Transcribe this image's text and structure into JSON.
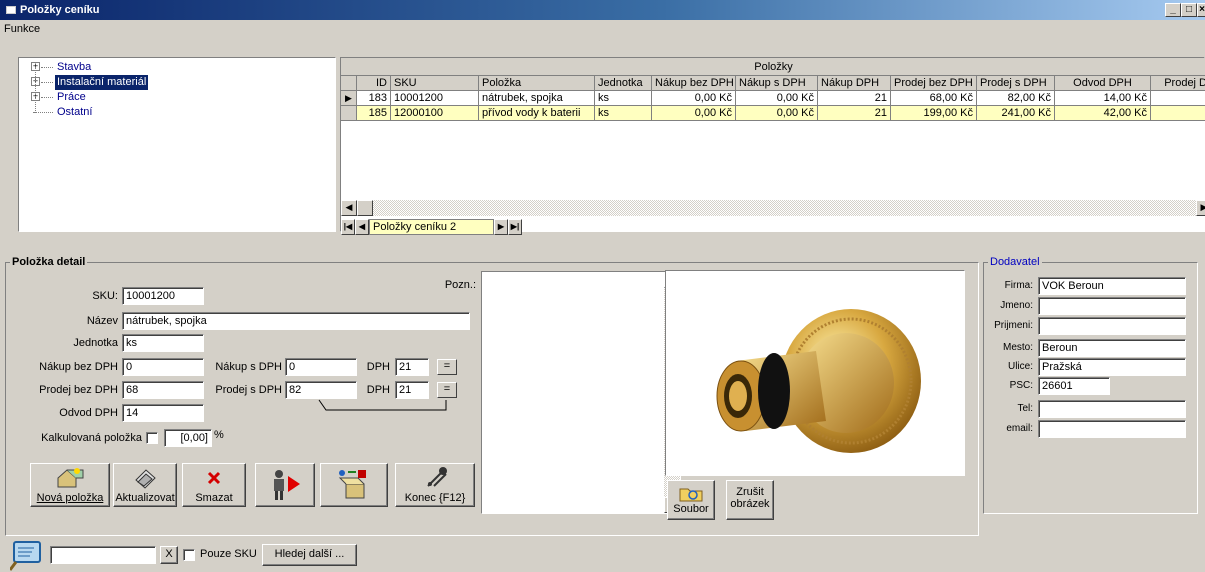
{
  "window": {
    "title": "Položky ceníku"
  },
  "menu": {
    "funkce": "Funkce"
  },
  "tree": {
    "items": [
      {
        "label": "Stavba",
        "expander": "+",
        "selected": false
      },
      {
        "label": "Instalační materiál",
        "expander": "+",
        "selected": true
      },
      {
        "label": "Práce",
        "expander": "+",
        "selected": false
      },
      {
        "label": "Ostatní",
        "expander": "",
        "selected": false
      }
    ]
  },
  "grid": {
    "title": "Položky",
    "columns": [
      "ID",
      "SKU",
      "Položka",
      "Jednotka",
      "Nákup bez DPH",
      "Nákup s DPH",
      "Nákup DPH",
      "Prodej bez DPH",
      "Prodej s DPH",
      "Odvod DPH",
      "Prodej D"
    ],
    "rows": [
      {
        "id": "183",
        "sku": "10001200",
        "polozka": "nátrubek, spojka",
        "jednotka": "ks",
        "nakup_bez": "0,00 Kč",
        "nakup_s": "0,00 Kč",
        "nakup_dph": "21",
        "prodej_bez": "68,00 Kč",
        "prodej_s": "82,00 Kč",
        "odvod": "14,00 Kč"
      },
      {
        "id": "185",
        "sku": "12000100",
        "polozka": "přívod vody k baterii",
        "jednotka": "ks",
        "nakup_bez": "0,00 Kč",
        "nakup_s": "0,00 Kč",
        "nakup_dph": "21",
        "prodej_bez": "199,00 Kč",
        "prodej_s": "241,00 Kč",
        "odvod": "42,00 Kč"
      }
    ],
    "nav_label": "Položky ceníku 2"
  },
  "detail": {
    "title": "Položka detail",
    "sku_label": "SKU:",
    "sku_value": "10001200",
    "nazev_label": "Název",
    "nazev_value": "nátrubek, spojka",
    "jednotka_label": "Jednotka",
    "jednotka_value": "ks",
    "nakup_bez_label": "Nákup bez DPH",
    "nakup_bez_value": "0",
    "nakup_s_label": "Nákup s DPH",
    "nakup_s_value": "0",
    "dph_label": "DPH",
    "dph1_value": "21",
    "dph2_value": "21",
    "prodej_bez_label": "Prodej bez DPH",
    "prodej_bez_value": "68",
    "prodej_s_label": "Prodej s DPH",
    "prodej_s_value": "82",
    "odvod_label": "Odvod DPH",
    "odvod_value": "14",
    "kalk_label": "Kalkulovaná položka",
    "kalk_value": "[0,00]",
    "kalk_unit": "%",
    "eq": "=",
    "pozn_label": "Pozn.:"
  },
  "buttons": {
    "nova": "Nová položka",
    "aktualizovat": "Aktualizovat",
    "smazat": "Smazat",
    "konec": "Konec {F12}",
    "soubor": "Soubor",
    "zrusit1": "Zrušit",
    "zrusit2": "obrázek"
  },
  "dodavatel": {
    "title": "Dodavatel",
    "firma_label": "Firma:",
    "firma": "VOK Beroun",
    "jmeno_label": "Jmeno:",
    "jmeno": "",
    "prijmeni_label": "Prijmeni:",
    "prijmeni": "",
    "mesto_label": "Mesto:",
    "mesto": "Beroun",
    "ulice_label": "Ulice:",
    "ulice": "Pražská",
    "psc_label": "PSC:",
    "psc": "26601",
    "tel_label": "Tel:",
    "tel": "",
    "email_label": "email:",
    "email": ""
  },
  "search": {
    "value": "",
    "clear": "X",
    "pouze_sku": "Pouze SKU",
    "hledej": "Hledej další ..."
  }
}
